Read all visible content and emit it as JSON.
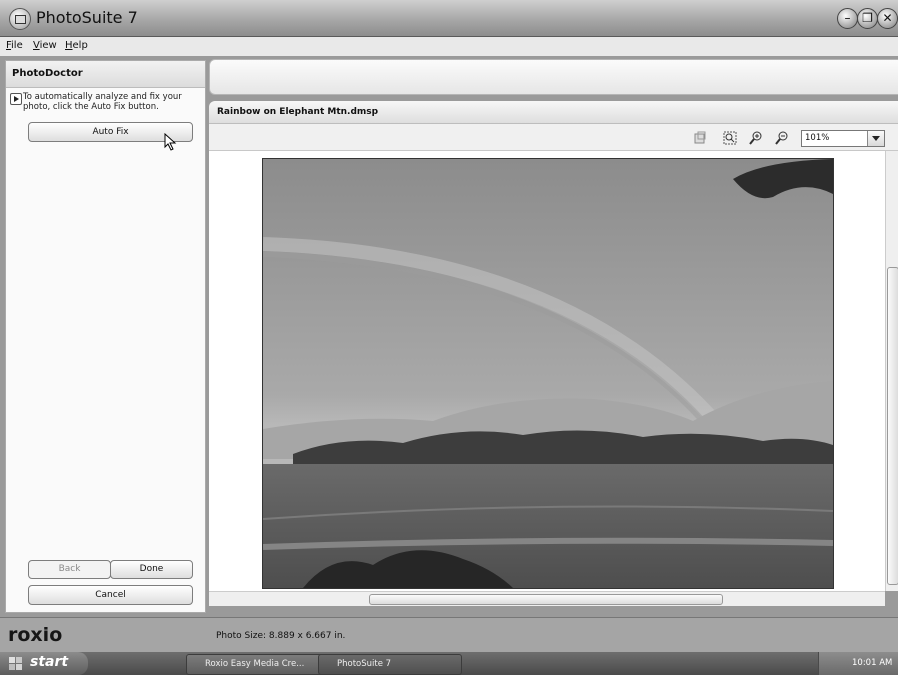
{
  "window": {
    "title": "PhotoSuite 7"
  },
  "menu": {
    "items": [
      "File",
      "View",
      "Help"
    ]
  },
  "left_panel": {
    "header": "PhotoDoctor",
    "instruction": "To automatically analyze and fix your photo, click the Auto Fix button.",
    "auto_fix_label": "Auto Fix",
    "back_label": "Back",
    "done_label": "Done",
    "cancel_label": "Cancel"
  },
  "document": {
    "title": "Rainbow on Elephant Mtn.dmsp",
    "zoom": "101%"
  },
  "status": {
    "logo": "roxio",
    "photo_size": "Photo Size: 8.889 x 6.667 in."
  },
  "taskbar": {
    "start_label": "start",
    "tasks": [
      "Roxio Easy Media Cre...",
      "PhotoSuite 7"
    ],
    "clock": "10:01 AM"
  },
  "icons": [
    "app-icon",
    "minimize-icon",
    "restore-icon",
    "close-icon",
    "play-icon",
    "crop-icon",
    "fit-icon",
    "zoom-in-icon",
    "zoom-out-icon",
    "chevron-down-icon",
    "start-flag-icon"
  ]
}
